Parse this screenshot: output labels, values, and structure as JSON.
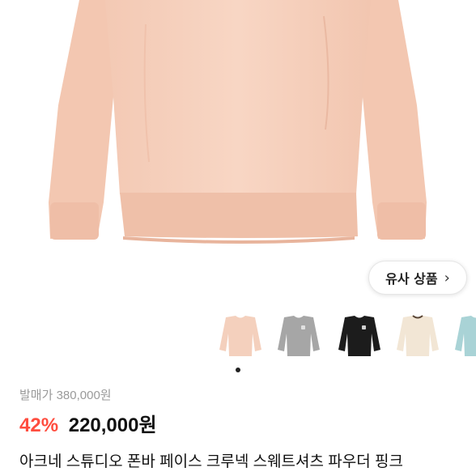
{
  "product": {
    "main_image": "peach-crewneck-sweatshirt",
    "main_color": "#f7d3bf"
  },
  "similar": {
    "label": "유사 상품",
    "chevron": "›"
  },
  "thumbnails": [
    {
      "color_name": "powder-pink",
      "color": "#f4d0bd"
    },
    {
      "color_name": "grey",
      "color": "#a6a6a6"
    },
    {
      "color_name": "black",
      "color": "#1c1c1c"
    },
    {
      "color_name": "cream",
      "color": "#f2e6d5"
    },
    {
      "color_name": "mint",
      "color": "#a9d3d6"
    }
  ],
  "pagination": {
    "active_index": 0
  },
  "price": {
    "original": "발매가 380,000원",
    "discount": "42%",
    "sale": "220,000원"
  },
  "title": "아크네 스튜디오 폰바 페이스 크루넥 스웨트셔츠 파우더 핑크"
}
